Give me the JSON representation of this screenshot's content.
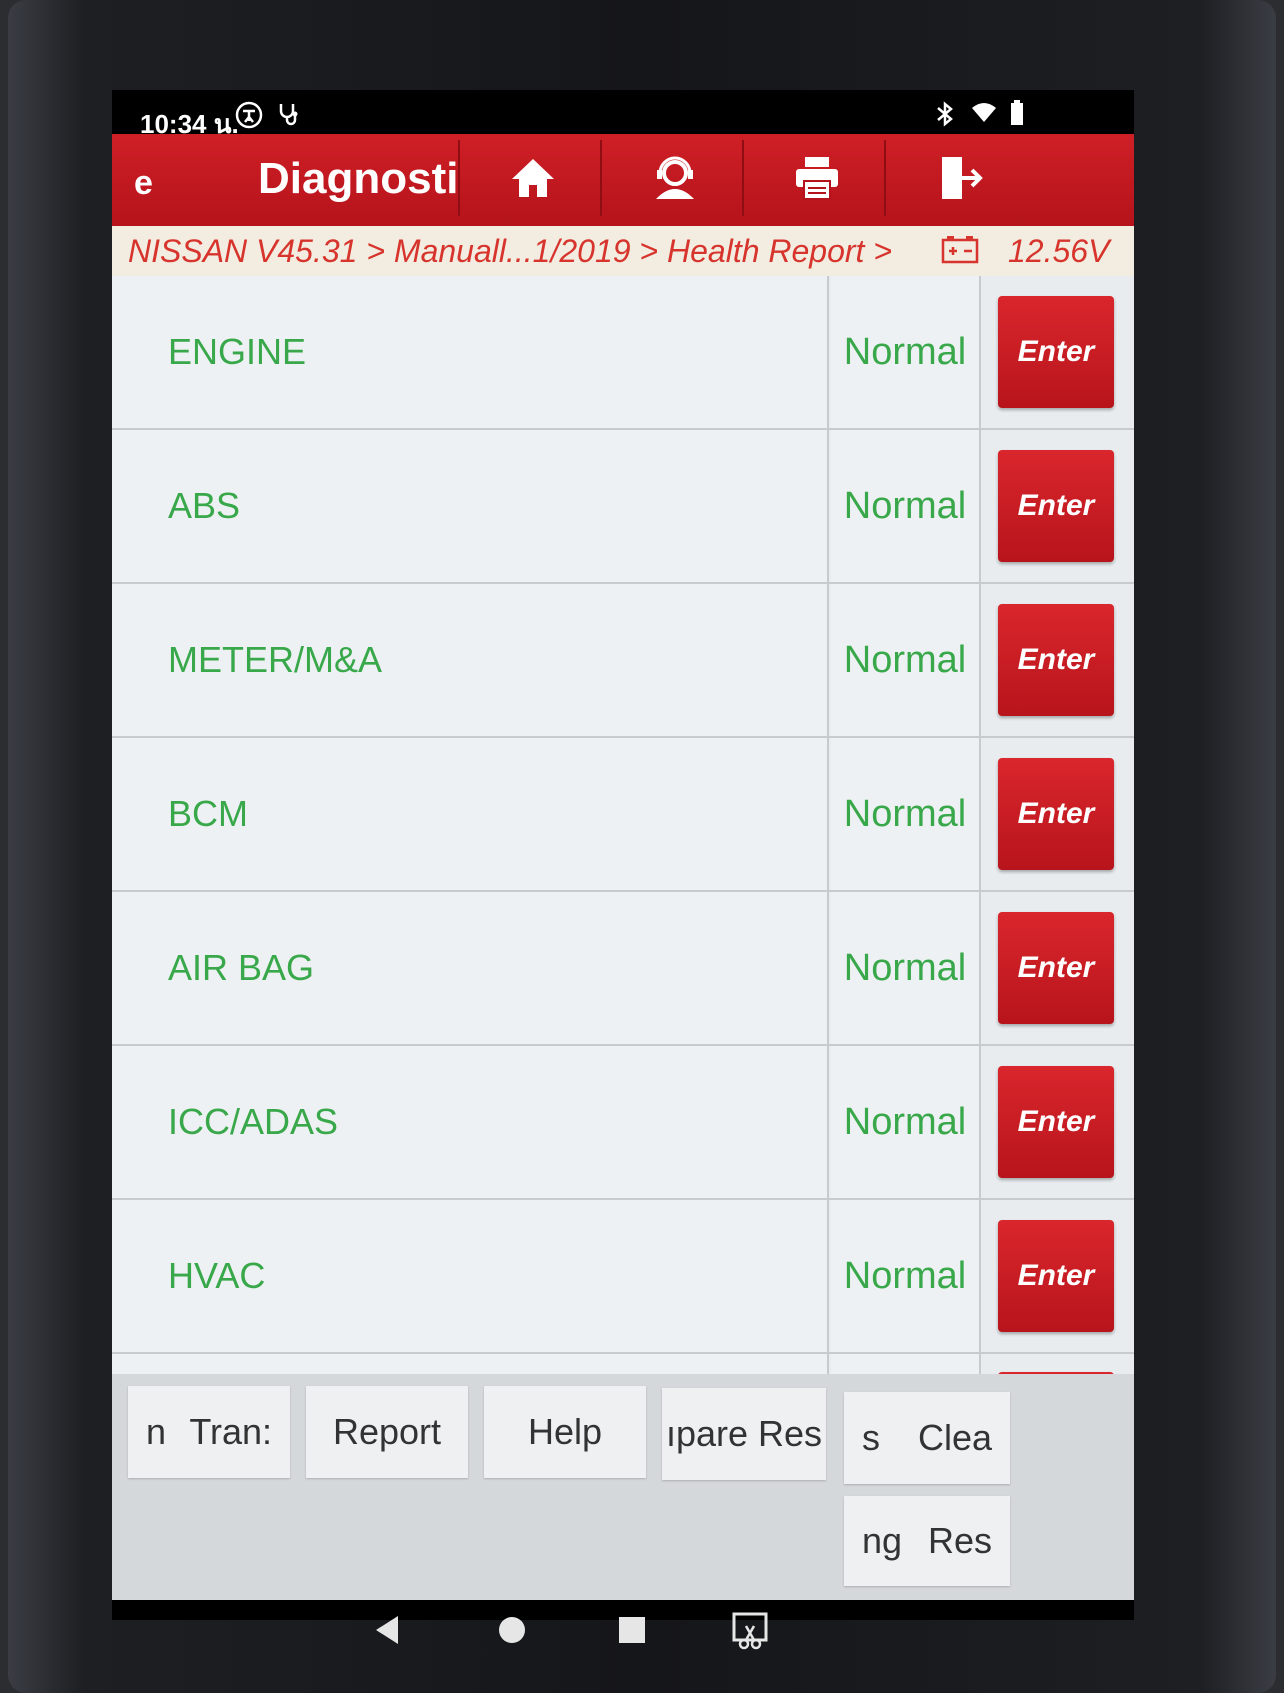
{
  "status_bar": {
    "time": "10:34 น.",
    "icons": [
      "accessibility-icon",
      "diagnostic-icon",
      "bluetooth-icon",
      "wifi-icon",
      "battery-icon"
    ]
  },
  "header": {
    "left_text": "e",
    "title": "Diagnosti",
    "buttons": [
      "home-icon",
      "support-agent-icon",
      "print-icon",
      "exit-icon"
    ]
  },
  "breadcrumb": {
    "path": "NISSAN V45.31 > Manuall...1/2019 > Health Report >",
    "voltage": "12.56V"
  },
  "systems": [
    {
      "name": "ENGINE",
      "status": "Normal",
      "action": "Enter"
    },
    {
      "name": "ABS",
      "status": "Normal",
      "action": "Enter"
    },
    {
      "name": "METER/M&A",
      "status": "Normal",
      "action": "Enter"
    },
    {
      "name": "BCM",
      "status": "Normal",
      "action": "Enter"
    },
    {
      "name": "AIR BAG",
      "status": "Normal",
      "action": "Enter"
    },
    {
      "name": "ICC/ADAS",
      "status": "Normal",
      "action": "Enter"
    },
    {
      "name": "HVAC",
      "status": "Normal",
      "action": "Enter"
    }
  ],
  "bottom_buttons": {
    "translate_a": "n",
    "translate_b": "Tran:",
    "report": "Report",
    "help": "Help",
    "compare": "ıpare Res",
    "clear_a": "s",
    "clear_b": "Clea",
    "reset_a": "ng",
    "reset_b": "Res"
  },
  "colors": {
    "header_red": "#c8181f",
    "status_green": "#38a84a",
    "breadcrumb_text": "#d6342c"
  }
}
